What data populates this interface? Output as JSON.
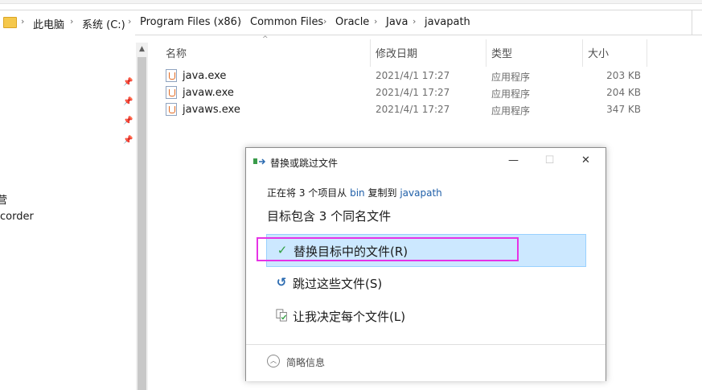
{
  "breadcrumb": {
    "items": [
      "此电脑",
      "系统 (C:)",
      "Program Files (x86)",
      "Common Files",
      "Oracle",
      "Java",
      "javapath"
    ]
  },
  "nav": {
    "partial_items": [
      "营",
      "corder"
    ]
  },
  "columns": {
    "name": "名称",
    "date": "修改日期",
    "type": "类型",
    "size": "大小"
  },
  "files": [
    {
      "name": "java.exe",
      "date": "2021/4/1 17:27",
      "type": "应用程序",
      "size": "203 KB"
    },
    {
      "name": "javaw.exe",
      "date": "2021/4/1 17:27",
      "type": "应用程序",
      "size": "204 KB"
    },
    {
      "name": "javaws.exe",
      "date": "2021/4/1 17:27",
      "type": "应用程序",
      "size": "347 KB"
    }
  ],
  "dialog": {
    "title": "替换或跳过文件",
    "status_prefix": "正在将 3 个项目从",
    "source": "bin",
    "status_middle": "复制到",
    "destination": "javapath",
    "heading": "目标包含 3 个同名文件",
    "options": {
      "replace": "替换目标中的文件(R)",
      "skip": "跳过这些文件(S)",
      "decide": "让我决定每个文件(L)"
    },
    "details": "简略信息",
    "min_glyph": "—",
    "max_glyph": "☐",
    "close_glyph": "✕"
  },
  "colors": {
    "accent": "#1f5fa8",
    "selected_bg": "#cce8ff",
    "highlight_border": "#e633e6",
    "check_green": "#2e9e3f"
  },
  "icons": {
    "folder": "folder-icon",
    "pin": "pin-icon",
    "check": "checkmark-icon",
    "skip": "skip-arrow-icon",
    "decide": "compare-files-icon",
    "details": "chevron-up-circle-icon"
  }
}
